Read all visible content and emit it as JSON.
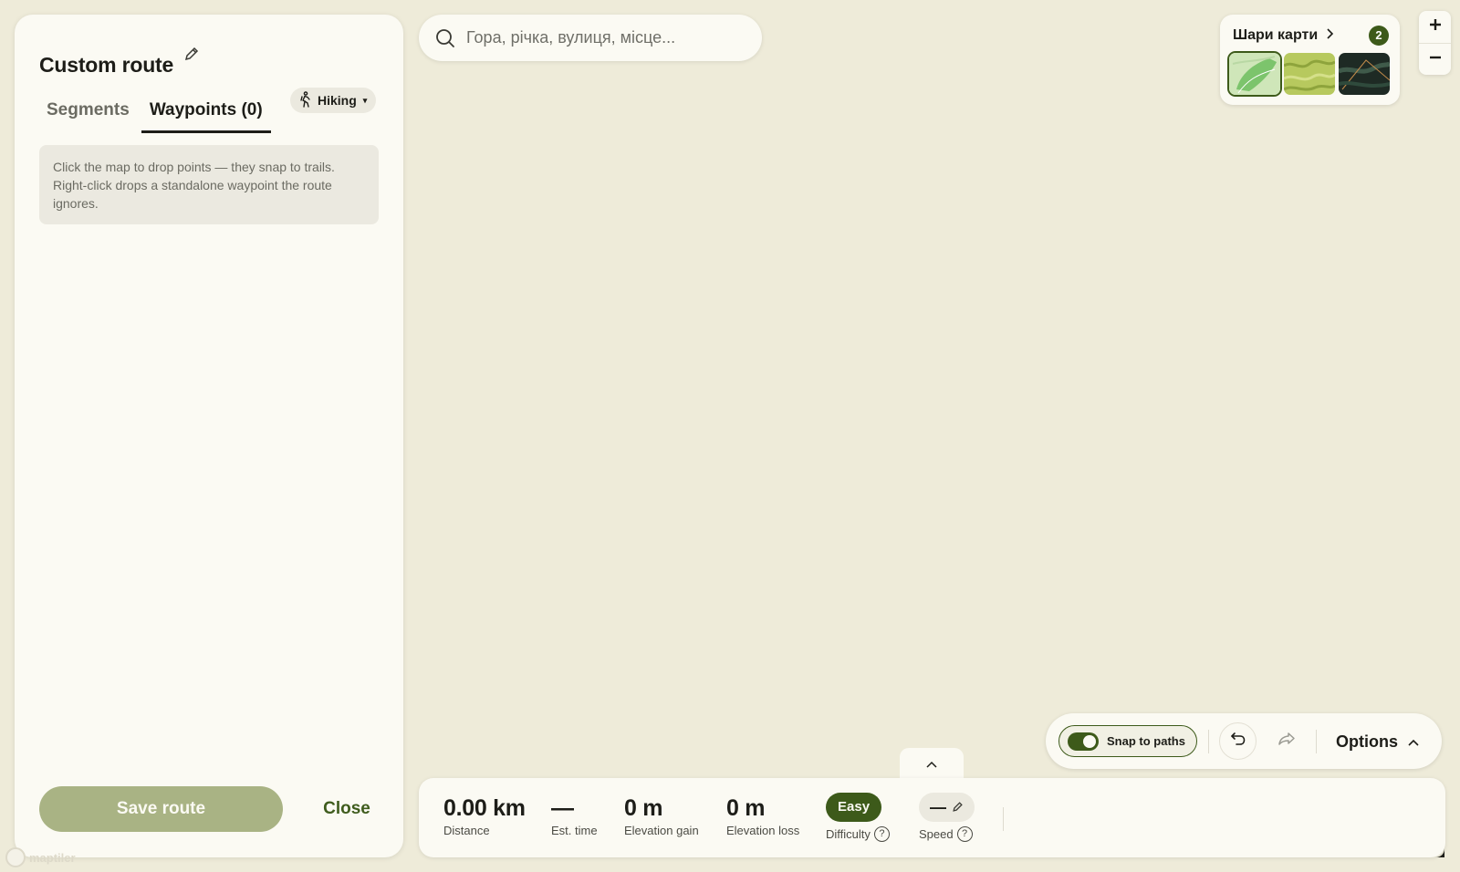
{
  "panel": {
    "title": "Custom route",
    "tabs": [
      {
        "label": "Segments",
        "active": false
      },
      {
        "label": "Waypoints (0)",
        "active": true
      }
    ],
    "mode_label": "Hiking",
    "hint": "Click the map to drop points — they snap to trails. Right-click drops a standalone waypoint the route ignores.",
    "save_label": "Save route",
    "close_label": "Close"
  },
  "search": {
    "placeholder": "Гора, річка, вулиця, місце..."
  },
  "layers": {
    "title": "Шари карти",
    "count": "2",
    "thumbnails": [
      {
        "name": "outdoor-map",
        "selected": true
      },
      {
        "name": "terrain-map",
        "selected": false
      },
      {
        "name": "satellite-map",
        "selected": false
      }
    ]
  },
  "toolbar": {
    "snap_label": "Snap to paths",
    "snap_enabled": true,
    "options_label": "Options"
  },
  "stats": {
    "distance_value": "0.00 km",
    "distance_label": "Distance",
    "time_value": "—",
    "time_label": "Est. time",
    "gain_value": "0 m",
    "gain_label": "Elevation gain",
    "loss_value": "0 m",
    "loss_label": "Elevation loss",
    "difficulty_value": "Easy",
    "difficulty_label": "Difficulty",
    "speed_value": "—",
    "speed_label": "Speed",
    "help_glyph": "?"
  },
  "attribution": {
    "text": "maptiler"
  },
  "colors": {
    "accent": "#3d5a1a",
    "save_disabled": "#a9b384",
    "map_background": "#eeebd9",
    "panel_background": "#fbfaf3"
  }
}
